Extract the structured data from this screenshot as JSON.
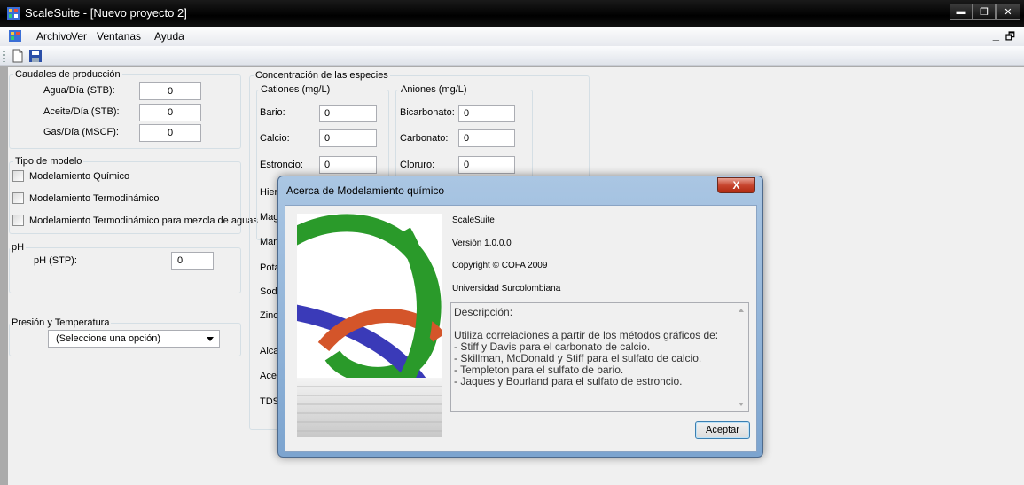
{
  "window": {
    "title": "ScaleSuite - [Nuevo proyecto 2]"
  },
  "menu": {
    "items": [
      "Archivo",
      "Ver",
      "Ventanas",
      "Ayuda"
    ]
  },
  "caudales": {
    "title": "Caudales de producción",
    "rows": [
      {
        "label": "Agua/Día (STB):",
        "value": "0"
      },
      {
        "label": "Aceite/Día (STB):",
        "value": "0"
      },
      {
        "label": "Gas/Día (MSCF):",
        "value": "0"
      }
    ]
  },
  "modelo": {
    "title": "Tipo de modelo",
    "options": [
      "Modelamiento Químico",
      "Modelamiento Termodinámico",
      "Modelamiento Termodinámico para mezcla de aguas"
    ]
  },
  "ph": {
    "title": "pH",
    "label": "pH (STP):",
    "value": "0"
  },
  "presion": {
    "title": "Presión y Temperatura",
    "selected": "(Seleccione una opción)"
  },
  "concentracion": {
    "title": "Concentración de las especies",
    "cationes": {
      "title": "Cationes (mg/L)",
      "rows": [
        {
          "label": "Bario:",
          "value": "0"
        },
        {
          "label": "Calcio:",
          "value": "0"
        },
        {
          "label": "Estroncio:",
          "value": "0"
        }
      ],
      "hidden_labels": [
        "Hierr",
        "Magn",
        "Mang",
        "Pota",
        "Sodi",
        "Zinc"
      ]
    },
    "aniones": {
      "title": "Aniones (mg/L)",
      "rows": [
        {
          "label": "Bicarbonato:",
          "value": "0"
        },
        {
          "label": "Carbonato:",
          "value": "0"
        },
        {
          "label": "Cloruro:",
          "value": "0"
        }
      ]
    },
    "extra_labels": [
      "Alcal",
      "Acet",
      "TDS"
    ]
  },
  "about": {
    "title": "Acerca de Modelamiento químico",
    "close": "X",
    "product": "ScaleSuite",
    "version": "Versión 1.0.0.0",
    "copyright": "Copyright © COFA 2009",
    "company": "Universidad Surcolombiana",
    "description": "Descripción:\n\nUtiliza correlaciones a partir de los métodos gráficos de:\n- Stiff y Davis para el carbonato de calcio.\n- Skillman, McDonald y Stiff para el sulfato de calcio.\n- Templeton para el sulfato de bario.\n- Jaques y Bourland para el sulfato de estroncio.",
    "ok": "Aceptar"
  },
  "colors": {
    "logo_green": "#2a9a2a",
    "logo_blue": "#3a3ab8",
    "logo_red": "#d4552a"
  }
}
